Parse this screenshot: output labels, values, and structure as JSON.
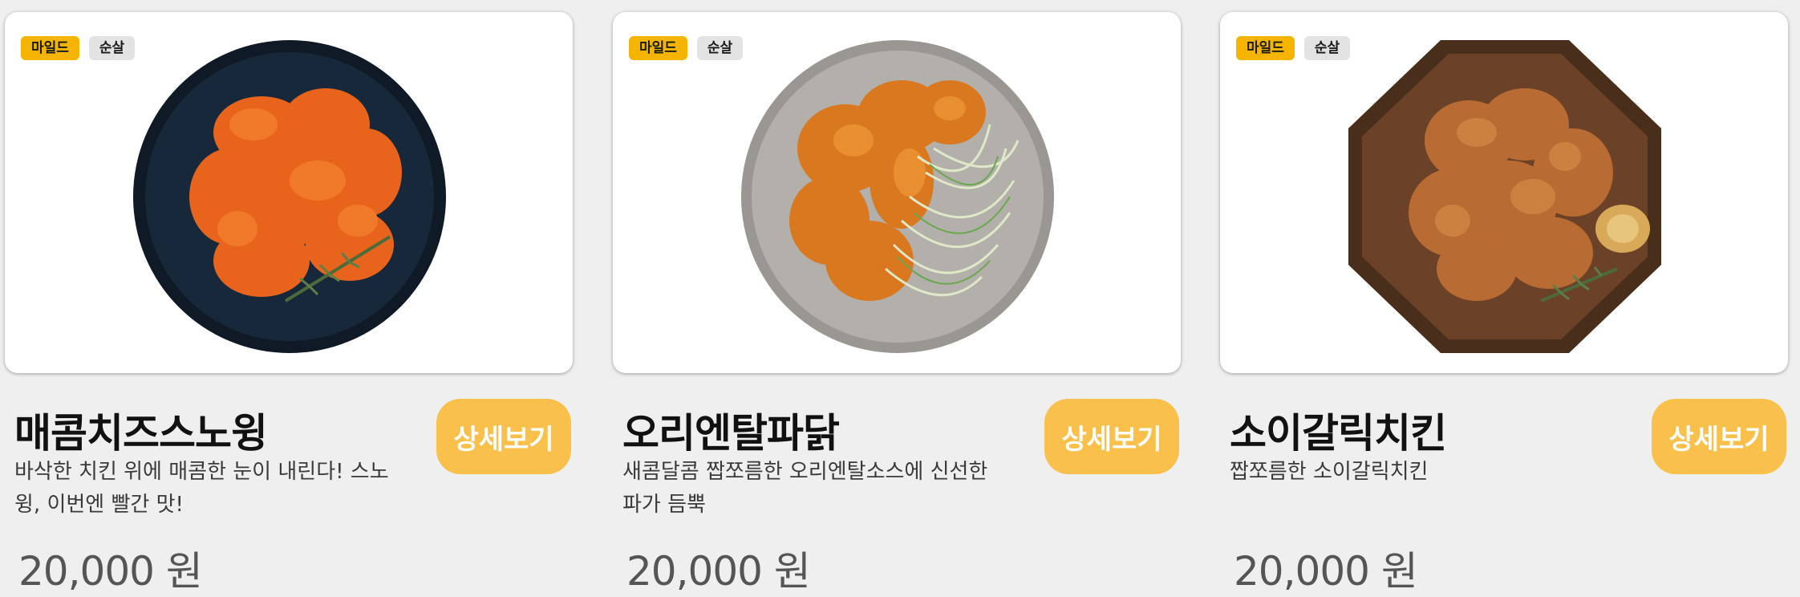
{
  "menu": [
    {
      "tags": [
        "마일드",
        "순살"
      ],
      "name": "매콤치즈스노윙",
      "description": "바삭한 치킨 위에 매콤한 눈이 내린다! 스노윙, 이번엔 빨간 맛!",
      "price": "20,000 원",
      "button": "상세보기",
      "image_alt": "spicy-cheese-snowing-chicken-on-dark-plate"
    },
    {
      "tags": [
        "마일드",
        "순살"
      ],
      "name": "오리엔탈파닭",
      "description": "새콤달콤 짭쪼름한 오리엔탈소스에 신선한 파가 듬뿍",
      "price": "20,000 원",
      "button": "상세보기",
      "image_alt": "oriental-chicken-with-green-onion-on-grey-plate"
    },
    {
      "tags": [
        "마일드",
        "순살"
      ],
      "name": "소이갈릭치킨",
      "description": "짭쪼름한 소이갈릭치킨",
      "price": "20,000 원",
      "button": "상세보기",
      "image_alt": "soy-garlic-chicken-on-octagonal-wooden-tray"
    }
  ],
  "colors": {
    "page_background": "#efefef",
    "spicy_tag": "#f4b400",
    "type_tag": "#e3e3e3",
    "detail_button": "#f9c14c"
  }
}
